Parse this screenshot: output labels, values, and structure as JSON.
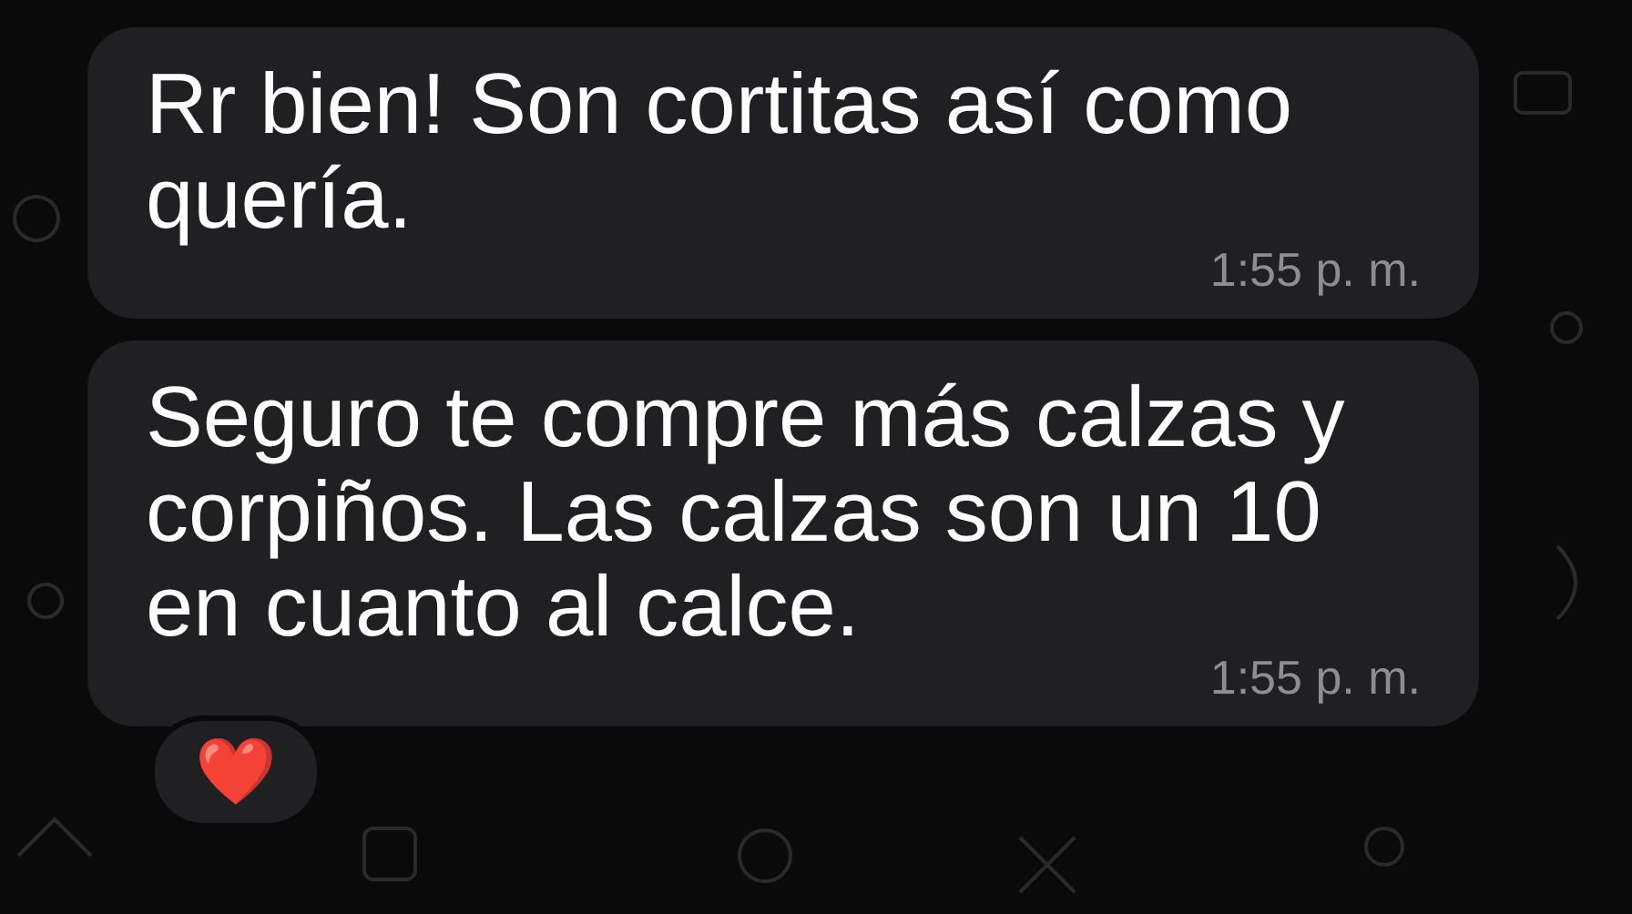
{
  "messages": [
    {
      "text": "Rr bien! Son cortitas así como quería.",
      "time": "1:55 p. m."
    },
    {
      "text": "Seguro te compre más calzas y corpiños. Las calzas son un 10 en cuanto al calce.",
      "time": "1:55 p. m.",
      "reaction": "❤️"
    }
  ]
}
